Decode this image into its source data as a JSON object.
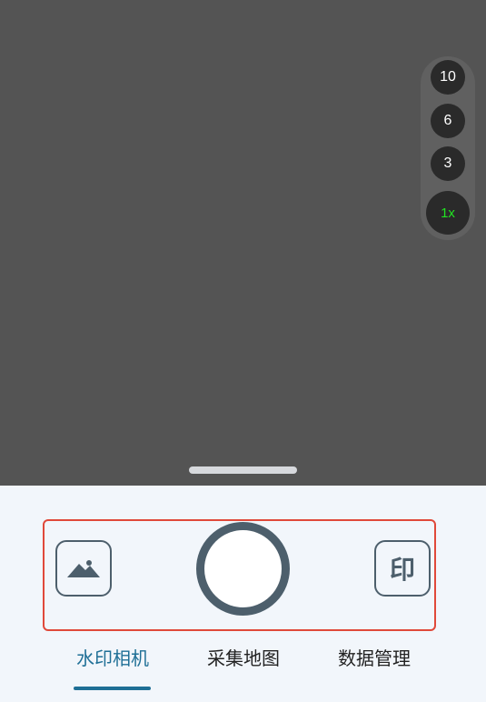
{
  "zoom": {
    "levels": [
      {
        "label": "10",
        "active": false
      },
      {
        "label": "6",
        "active": false
      },
      {
        "label": "3",
        "active": false
      },
      {
        "label": "1x",
        "active": true
      }
    ]
  },
  "controls": {
    "gallery_icon": "mountain-image-icon",
    "watermark_label": "印"
  },
  "tabs": [
    {
      "label": "水印相机",
      "active": true
    },
    {
      "label": "采集地图",
      "active": false
    },
    {
      "label": "数据管理",
      "active": false
    }
  ],
  "colors": {
    "active_zoom_text": "#21e321",
    "active_tab": "#1f6f96",
    "highlight_border": "#e0493a",
    "control_stroke": "#4d5f6c"
  }
}
